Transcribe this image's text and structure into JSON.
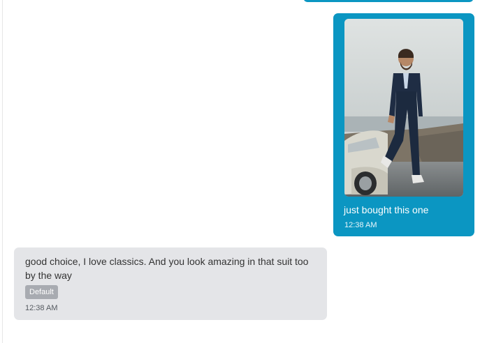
{
  "messages": [
    {
      "direction": "outgoing",
      "image": "man-in-suit-with-classic-car-photo",
      "text": "just bought this one",
      "time": "12:38 AM"
    },
    {
      "direction": "incoming",
      "text": "good choice, I love classics. And you look amazing in that suit too by the way",
      "badge": "Default",
      "time": "12:38 AM"
    }
  ],
  "colors": {
    "outgoing_bubble": "#0b96c2",
    "incoming_bubble": "#e4e5e8",
    "badge": "#a8abb1"
  }
}
